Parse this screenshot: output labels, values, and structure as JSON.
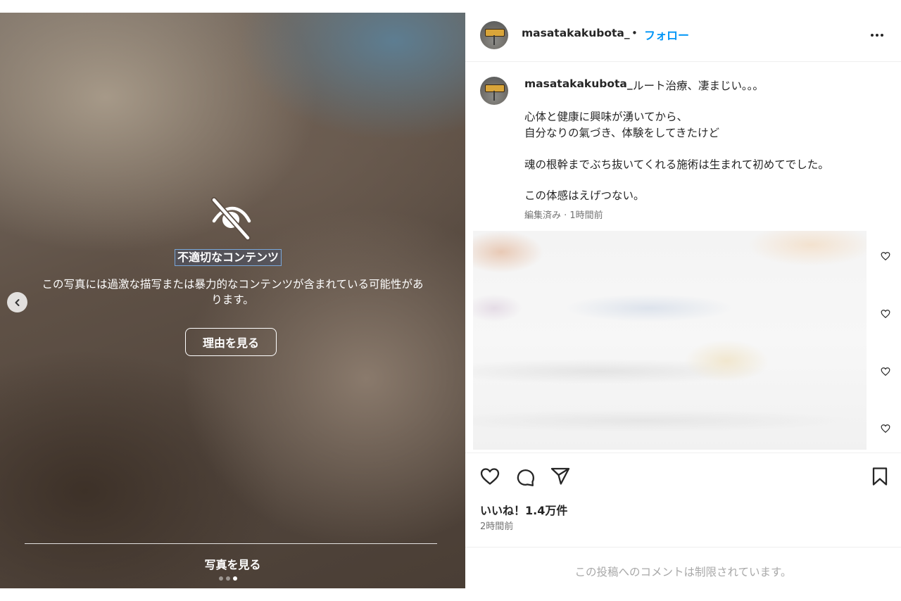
{
  "media": {
    "warning_title": "不適切なコンテンツ",
    "warning_description": "この写真には過激な描写または暴力的なコンテンツが含まれている可能性があります。",
    "reason_button": "理由を見る",
    "view_photo": "写真を見る",
    "carousel": {
      "total": 3,
      "current": 3
    },
    "icons": [
      "hidden-eye-icon",
      "chevron-left-icon"
    ]
  },
  "header": {
    "username": "masatakakubota_",
    "separator": "•",
    "follow_label": "フォロー"
  },
  "caption": {
    "username": "masatakakubota_",
    "first_line": "ルート治療、凄まじい｡｡｡",
    "lines": [
      "心体と健康に興味が湧いてから、",
      "自分なりの氣づき、体験をしてきたけど",
      "魂の根幹までぶち抜いてくれる施術は生まれて初めてでした。",
      "この体感はえげつない。"
    ],
    "meta": "編集済み · 1時間前"
  },
  "actions": {
    "icons": [
      "like-heart-icon",
      "comment-icon",
      "share-icon",
      "save-bookmark-icon"
    ],
    "likes": "いいね！1.4万件",
    "time": "2時間前"
  },
  "comments": {
    "restricted_message": "この投稿へのコメントは制限されています。"
  },
  "colors": {
    "accent": "#0095f6",
    "secondary_text": "#737373",
    "divider": "#efefef"
  }
}
